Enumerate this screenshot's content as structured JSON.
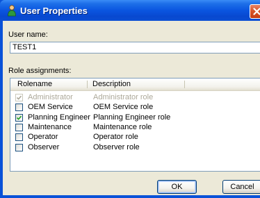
{
  "window": {
    "title": "User Properties"
  },
  "form": {
    "username_label": "User name:",
    "username_value": "TEST1",
    "roles_label": "Role assignments:"
  },
  "roles_table": {
    "columns": [
      "Rolename",
      "Description"
    ],
    "rows": [
      {
        "rolename": "Administrator",
        "description": "Administrator role",
        "checked": true,
        "enabled": false
      },
      {
        "rolename": "OEM Service",
        "description": "OEM Service role",
        "checked": false,
        "enabled": true
      },
      {
        "rolename": "Planning Engineer",
        "description": "Planning Engineer role",
        "checked": true,
        "enabled": true
      },
      {
        "rolename": "Maintenance",
        "description": "Maintenance role",
        "checked": false,
        "enabled": true
      },
      {
        "rolename": "Operator",
        "description": "Operator role",
        "checked": false,
        "enabled": true
      },
      {
        "rolename": "Observer",
        "description": "Observer role",
        "checked": false,
        "enabled": true
      }
    ]
  },
  "buttons": {
    "ok": "OK",
    "cancel": "Cancel"
  },
  "icons": {
    "title": "user-icon",
    "close": "close-icon",
    "check": "check-icon"
  },
  "colors": {
    "titlebar": "#0a55e0",
    "dialog_face": "#ece9d8",
    "close_button": "#d9552a",
    "disabled_text": "#aca899"
  }
}
